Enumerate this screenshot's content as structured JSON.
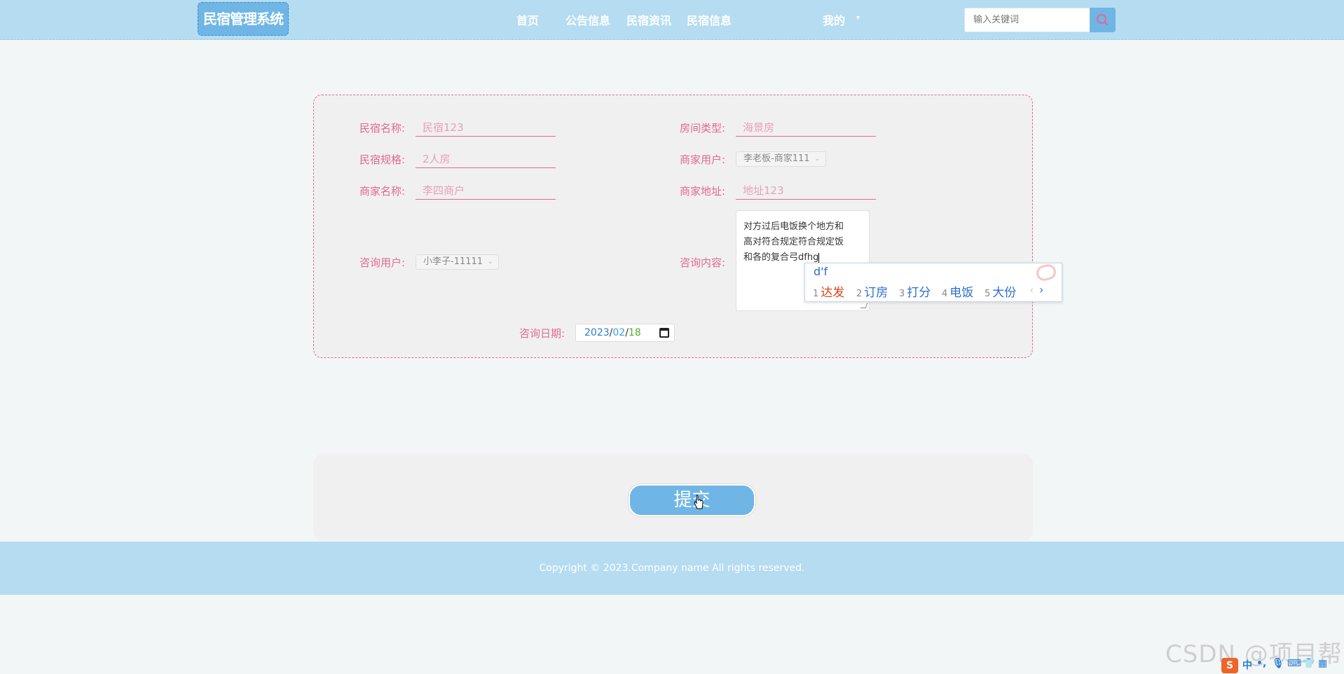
{
  "header": {
    "logo": "民宿管理系统",
    "nav": [
      "首页",
      "公告信息",
      "民宿资讯",
      "民宿信息"
    ],
    "user_menu": "我的",
    "search_placeholder": "输入关键词"
  },
  "form": {
    "fields": {
      "homestay_name": {
        "label": "民宿名称:",
        "value": "民宿123"
      },
      "room_type": {
        "label": "房间类型:",
        "value": "海景房"
      },
      "homestay_spec": {
        "label": "民宿规格:",
        "value": "2人房"
      },
      "merchant_user": {
        "label": "商家用户:",
        "value": "李老板-商家111"
      },
      "merchant_name": {
        "label": "商家名称:",
        "value": "李四商户"
      },
      "merchant_address": {
        "label": "商家地址:",
        "value": "地址123"
      },
      "consult_user": {
        "label": "咨询用户:",
        "value": "小李子-11111"
      },
      "consult_content": {
        "label": "咨询内容:",
        "lines": [
          "对方过后电饭换个地方和",
          "高对符合规定符合规定饭",
          "和各的复合弓dfhg"
        ]
      },
      "consult_date": {
        "label": "咨询日期:",
        "year": "2023",
        "month": "02",
        "day": "18"
      }
    },
    "submit_label": "提交"
  },
  "ime": {
    "pinyin": "d'f",
    "candidates": [
      {
        "num": "1",
        "word": "达发"
      },
      {
        "num": "2",
        "word": "订房"
      },
      {
        "num": "3",
        "word": "打分"
      },
      {
        "num": "4",
        "word": "电饭"
      },
      {
        "num": "5",
        "word": "大份"
      }
    ],
    "prev": "‹",
    "next": "›"
  },
  "footer": {
    "copyright": "Copyright © 2023.Company name All rights reserved."
  },
  "watermark": "CSDN @项目帮",
  "tray": {
    "logo": "S",
    "lang": "中",
    "punct": "•,",
    "icons": [
      "mic-icon",
      "keyboard-icon",
      "shirt-icon",
      "apps-icon"
    ]
  }
}
